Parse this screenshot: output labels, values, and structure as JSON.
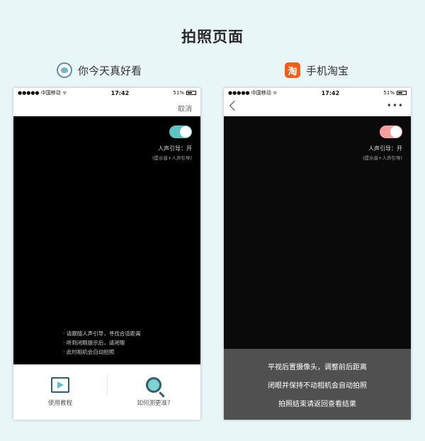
{
  "page_title": "拍照页面",
  "apps": {
    "left": {
      "name": "你今天真好看"
    },
    "right": {
      "name": "手机淘宝",
      "logo_char": "淘"
    }
  },
  "left_screen": {
    "status": {
      "carrier": "●●●●● 中国移动 ᯤ",
      "time": "17:42",
      "battery": "51%"
    },
    "nav": {
      "cancel_label": "取消"
    },
    "toggle": {
      "on": true,
      "color": "#5ec3c3"
    },
    "voice_guide_label": "人声引导：开",
    "voice_guide_sub": "(提示音+人声引导)",
    "tips": [
      "· 请跟随人声引导，寻找合适距离",
      "· 听到闭眼提示后，请闭眼",
      "· 此时相机会自动拍照"
    ],
    "bottom": {
      "tutorial_label": "使用教程",
      "tutorial_icon": "video-tutorial-icon",
      "accuracy_label": "如何测更准?",
      "accuracy_icon": "magnifier-icon"
    }
  },
  "right_screen": {
    "status": {
      "carrier": "●●●●● 中国移动 ᯤ",
      "time": "17:42",
      "battery": "51%"
    },
    "toggle": {
      "on": true,
      "color": "#f4a0a0"
    },
    "voice_guide_label": "人声引导：开",
    "voice_guide_sub": "(提示音+人声引导)",
    "panel_lines": [
      "平视后置摄像头，调整前后距离",
      "闭眼并保持不动相机会自动拍照",
      "拍照结束请返回查看结果"
    ]
  }
}
